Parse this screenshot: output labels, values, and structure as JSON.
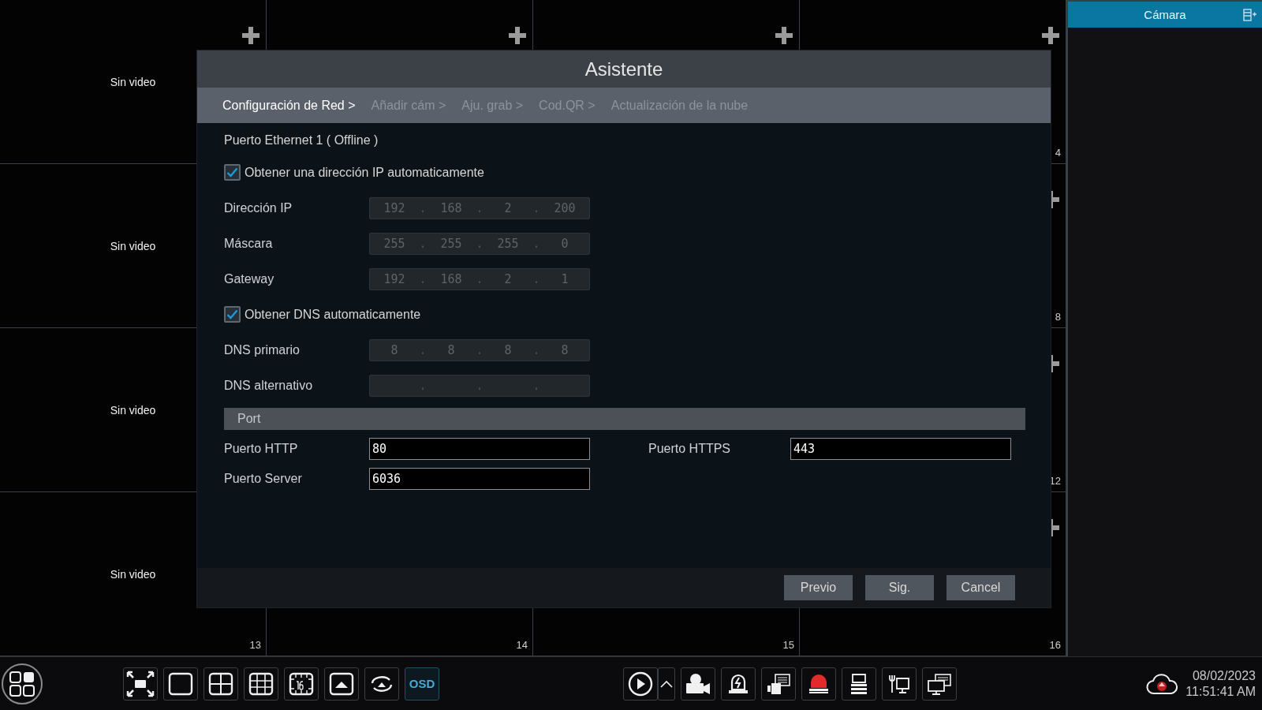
{
  "tiles": [
    {
      "kind": "full",
      "label": "Sin video"
    },
    {
      "kind": "full"
    },
    {
      "kind": "full"
    },
    {
      "kind": "full",
      "number": "4"
    },
    {
      "kind": "partial",
      "label": "Sin video"
    },
    {
      "kind": "hidden"
    },
    {
      "kind": "hidden"
    },
    {
      "kind": "full",
      "number": "8"
    },
    {
      "kind": "partial",
      "label": "Sin video"
    },
    {
      "kind": "hidden"
    },
    {
      "kind": "hidden"
    },
    {
      "kind": "full",
      "number": "12"
    },
    {
      "kind": "partial",
      "label": "Sin video",
      "number": "13"
    },
    {
      "kind": "partial",
      "number": "14"
    },
    {
      "kind": "partial",
      "number": "15"
    },
    {
      "kind": "full",
      "number": "16"
    }
  ],
  "side_panel": {
    "title": "Cámara"
  },
  "dialog": {
    "title": "Asistente",
    "steps": [
      {
        "label": "Configuración de Red >",
        "selected": true
      },
      {
        "label": "Añadir cám >",
        "selected": false
      },
      {
        "label": "Aju. grab >",
        "selected": false
      },
      {
        "label": "Cod.QR >",
        "selected": false
      },
      {
        "label": "Actualización de la nube",
        "selected": false
      }
    ],
    "section": "Puerto Ethernet 1 ( Offline )",
    "rows": [
      {
        "kind": "checkbox",
        "label": "Obtener una dirección IP automaticamente",
        "checked": true
      },
      {
        "kind": "ip",
        "label": "Dirección IP",
        "octets": [
          "192",
          "168",
          "2",
          "200"
        ],
        "separator": ".",
        "disabled": true
      },
      {
        "kind": "ip",
        "label": "Máscara",
        "octets": [
          "255",
          "255",
          "255",
          "0"
        ],
        "separator": ".",
        "disabled": true
      },
      {
        "kind": "ip",
        "label": "Gateway",
        "octets": [
          "192",
          "168",
          "2",
          "1"
        ],
        "separator": ".",
        "disabled": true
      },
      {
        "kind": "checkbox",
        "label": "Obtener DNS automaticamente",
        "checked": true
      },
      {
        "kind": "ip",
        "label": "DNS primario",
        "octets": [
          "8",
          "8",
          "8",
          "8"
        ],
        "separator": ".",
        "disabled": true
      },
      {
        "kind": "ip",
        "label": "DNS alternativo",
        "separator": ".",
        "disabled": true
      }
    ],
    "port_header": "Port",
    "ports": [
      {
        "label": "Puerto HTTP",
        "value": "80"
      },
      {
        "label": "Puerto HTTPS",
        "value": "443"
      },
      {
        "label": "Puerto Server",
        "value": "6036"
      }
    ],
    "buttons": [
      "Previo",
      "Sig.",
      "Cancel"
    ]
  },
  "toolbar": {
    "osd": {
      "label": "OSD",
      "selected": true
    },
    "date": "08/02/2023",
    "time": "11:51:41 AM"
  }
}
